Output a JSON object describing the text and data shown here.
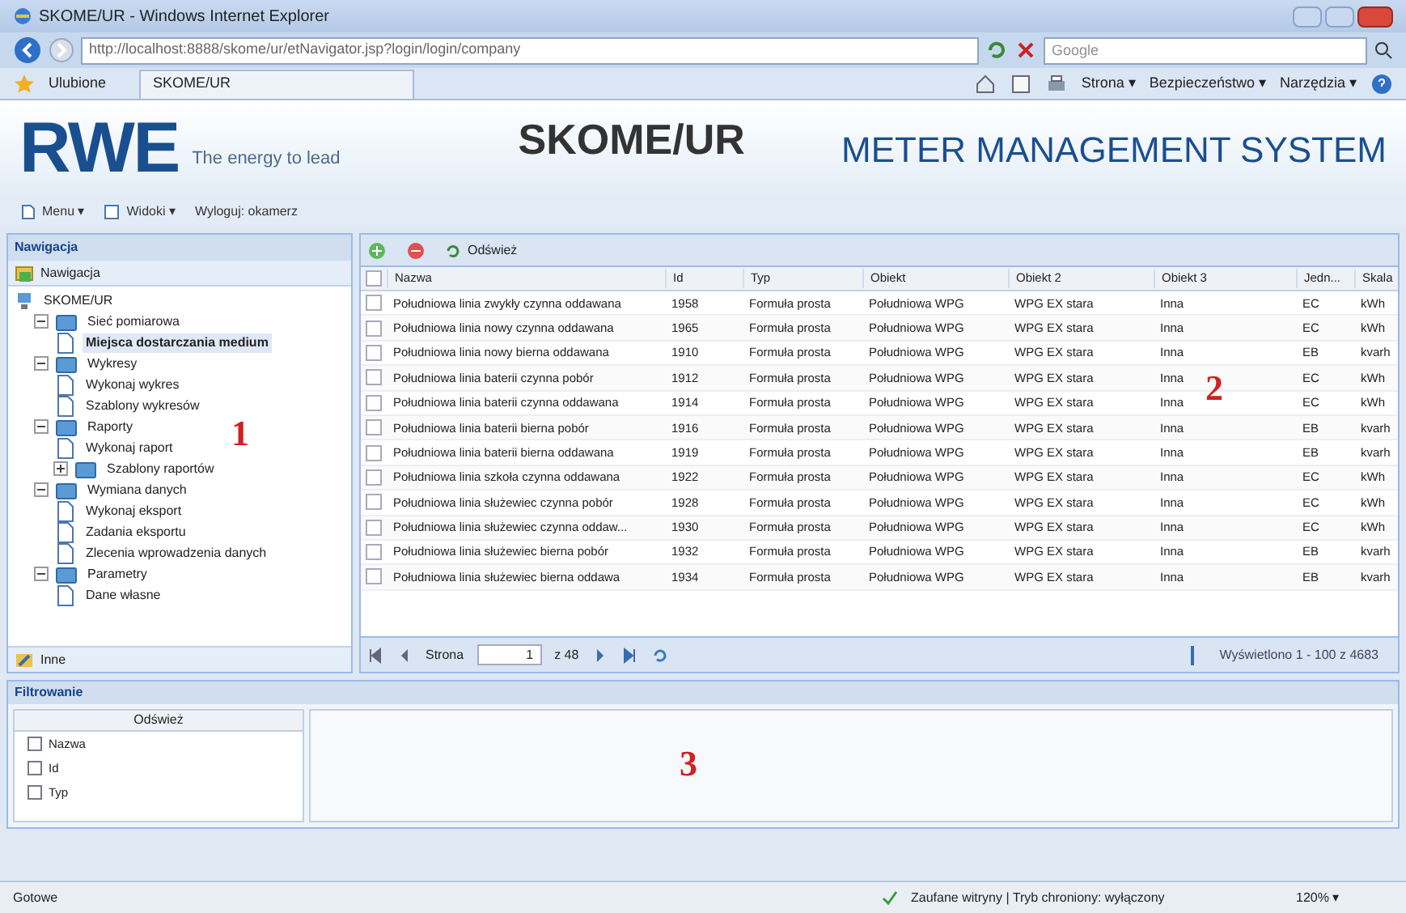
{
  "window": {
    "title": "SKOME/UR - Windows Internet Explorer"
  },
  "address_bar": {
    "url": "http://localhost:8888/skome/ur/etNavigator.jsp?login/login/company",
    "search_placeholder": "Google"
  },
  "favorites_bar": {
    "favorites": "Ulubione",
    "tab": "SKOME/UR",
    "commands": [
      "Strona ▾",
      "Bezpieczeństwo ▾",
      "Narzędzia ▾"
    ]
  },
  "header": {
    "logo": "RWE",
    "slogan": "The energy to lead",
    "app_title": "SKOME/UR",
    "system_title": "METER MANAGEMENT SYSTEM"
  },
  "app_toolbar": {
    "items": [
      "Menu ▾",
      "Widoki ▾",
      "Wyloguj: okamerz"
    ]
  },
  "navigation": {
    "title": "Nawigacja",
    "section": "Nawigacja",
    "footer": "Inne",
    "annotation": "1",
    "tree": [
      {
        "label": "SKOME/UR",
        "kind": "root",
        "children": [
          {
            "label": "Sieć pomiarowa",
            "kind": "folder",
            "expanded": true,
            "children": [
              {
                "label": "Miejsca dostarczania medium",
                "kind": "page",
                "selected": true
              }
            ]
          },
          {
            "label": "Wykresy",
            "kind": "folder",
            "expanded": true,
            "children": [
              {
                "label": "Wykonaj wykres",
                "kind": "page",
                "selected": false
              },
              {
                "label": "Szablony wykresów",
                "kind": "page",
                "selected": false
              }
            ]
          },
          {
            "label": "Raporty",
            "kind": "folder",
            "expanded": true,
            "children": [
              {
                "label": "Wykonaj raport",
                "kind": "page",
                "selected": false
              },
              {
                "label": "Szablony raportów",
                "kind": "folder",
                "expanded": false
              }
            ]
          },
          {
            "label": "Wymiana danych",
            "kind": "folder",
            "expanded": true,
            "children": [
              {
                "label": "Wykonaj eksport",
                "kind": "page",
                "selected": false
              },
              {
                "label": "Zadania eksportu",
                "kind": "page",
                "selected": false
              },
              {
                "label": "Zlecenia wprowadzenia danych",
                "kind": "page",
                "selected": false
              }
            ]
          },
          {
            "label": "Parametry",
            "kind": "folder",
            "expanded": true,
            "children": [
              {
                "label": "Dane własne",
                "kind": "page",
                "selected": false
              }
            ]
          }
        ]
      }
    ]
  },
  "grid": {
    "refresh": "Odśwież",
    "annotation": "2",
    "all_checked": false,
    "columns": [
      "Nazwa",
      "Id",
      "Typ",
      "Obiekt",
      "Obiekt 2",
      "Obiekt 3",
      "Jedn...",
      "Skala"
    ],
    "rows": [
      {
        "checked": false,
        "cells": [
          "Południowa linia zwykły czynna oddawana",
          "1958",
          "Formuła prosta",
          "Południowa WPG",
          "WPG EX stara",
          "Inna",
          "EC",
          "kWh"
        ]
      },
      {
        "checked": false,
        "cells": [
          "Południowa linia nowy czynna oddawana",
          "1965",
          "Formuła prosta",
          "Południowa WPG",
          "WPG EX stara",
          "Inna",
          "EC",
          "kWh"
        ]
      },
      {
        "checked": false,
        "cells": [
          "Południowa linia nowy bierna oddawana",
          "1910",
          "Formuła prosta",
          "Południowa WPG",
          "WPG EX stara",
          "Inna",
          "EB",
          "kvarh"
        ]
      },
      {
        "checked": false,
        "cells": [
          "Południowa linia baterii czynna pobór",
          "1912",
          "Formuła prosta",
          "Południowa WPG",
          "WPG EX stara",
          "Inna",
          "EC",
          "kWh"
        ]
      },
      {
        "checked": false,
        "cells": [
          "Południowa linia baterii czynna oddawana",
          "1914",
          "Formuła prosta",
          "Południowa WPG",
          "WPG EX stara",
          "Inna",
          "EC",
          "kWh"
        ]
      },
      {
        "checked": false,
        "cells": [
          "Południowa linia baterii bierna pobór",
          "1916",
          "Formuła prosta",
          "Południowa WPG",
          "WPG EX stara",
          "Inna",
          "EB",
          "kvarh"
        ]
      },
      {
        "checked": false,
        "cells": [
          "Południowa linia baterii bierna oddawana",
          "1919",
          "Formuła prosta",
          "Południowa WPG",
          "WPG EX stara",
          "Inna",
          "EB",
          "kvarh"
        ]
      },
      {
        "checked": false,
        "cells": [
          "Południowa linia szkoła czynna oddawana",
          "1922",
          "Formuła prosta",
          "Południowa WPG",
          "WPG EX stara",
          "Inna",
          "EC",
          "kWh"
        ]
      },
      {
        "checked": false,
        "cells": [
          "Południowa linia służewiec czynna pobór",
          "1928",
          "Formuła prosta",
          "Południowa WPG",
          "WPG EX stara",
          "Inna",
          "EC",
          "kWh"
        ]
      },
      {
        "checked": false,
        "cells": [
          "Południowa linia służewiec czynna oddaw...",
          "1930",
          "Formuła prosta",
          "Południowa WPG",
          "WPG EX stara",
          "Inna",
          "EC",
          "kWh"
        ]
      },
      {
        "checked": false,
        "cells": [
          "Południowa linia służewiec bierna pobór",
          "1932",
          "Formuła prosta",
          "Południowa WPG",
          "WPG EX stara",
          "Inna",
          "EB",
          "kvarh"
        ]
      },
      {
        "checked": false,
        "cells": [
          "Południowa linia służewiec bierna oddawa",
          "1934",
          "Formuła prosta",
          "Południowa WPG",
          "WPG EX stara",
          "Inna",
          "EB",
          "kvarh"
        ]
      }
    ],
    "pager": {
      "label": "Strona",
      "page": "1",
      "total": "z 48",
      "summary": "Wyświetlono 1 - 100 z 4683"
    }
  },
  "filter": {
    "title": "Filtrowanie",
    "refresh": "Odśwież",
    "annotation": "3",
    "fields": [
      {
        "label": "Nazwa",
        "checked": false
      },
      {
        "label": "Id",
        "checked": false
      },
      {
        "label": "Typ",
        "checked": false
      }
    ]
  },
  "status_bar": {
    "text": "Gotowe",
    "zone": "Zaufane witryny | Tryb chroniony: wyłączony",
    "zoom": "120% ▾"
  }
}
